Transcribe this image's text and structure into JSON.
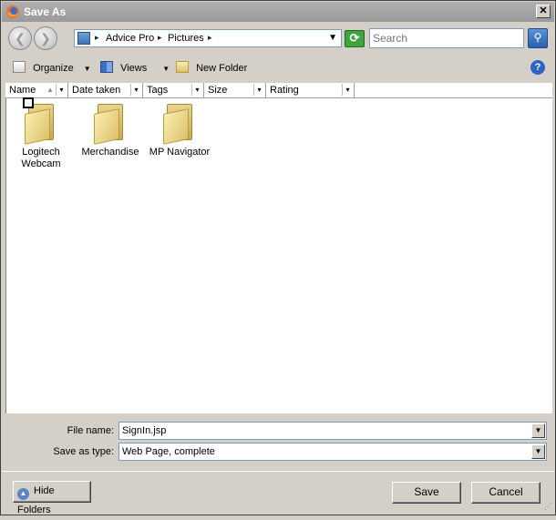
{
  "window": {
    "title": "Save As",
    "close_glyph": "✕"
  },
  "nav": {
    "back_icon": "back-arrow-icon",
    "forward_icon": "forward-arrow-icon",
    "back_glyph": "❮",
    "forward_glyph": "❯",
    "breadcrumbs": [
      "Advice Pro",
      "Pictures"
    ],
    "crumb_separator": "▸",
    "dropdown_glyph": "▼",
    "refresh_glyph": "⟳",
    "search_placeholder": "Search",
    "search_glyph": "⚲"
  },
  "toolbar": {
    "organize": "Organize",
    "views": "Views",
    "new_folder": "New Folder",
    "caret": "▼",
    "help_glyph": "?"
  },
  "columns": [
    {
      "label": "Name"
    },
    {
      "label": "Date taken"
    },
    {
      "label": "Tags"
    },
    {
      "label": "Size"
    },
    {
      "label": "Rating"
    }
  ],
  "column_sort_glyph": "▲",
  "column_drop_glyph": "▾",
  "folders": [
    {
      "name_line1": "Logitech",
      "name_line2": "Webcam",
      "checked": false
    },
    {
      "name_line1": "Merchandise",
      "name_line2": ""
    },
    {
      "name_line1": "MP Navigator",
      "name_line2": ""
    }
  ],
  "form": {
    "file_name_label": "File name:",
    "file_name_value": "SignIn.jsp",
    "save_type_label": "Save as type:",
    "save_type_value": "Web Page, complete",
    "combo_arrow": "▼"
  },
  "buttons": {
    "hide_folders": "Hide Folders",
    "hide_glyph": "▲",
    "save": "Save",
    "cancel": "Cancel"
  },
  "grip_glyph": "⋰",
  "colors": {
    "title_bar": "#9a9a9a",
    "selection_blue": "#7f9db9",
    "window_bg": "#d4d0c8"
  }
}
